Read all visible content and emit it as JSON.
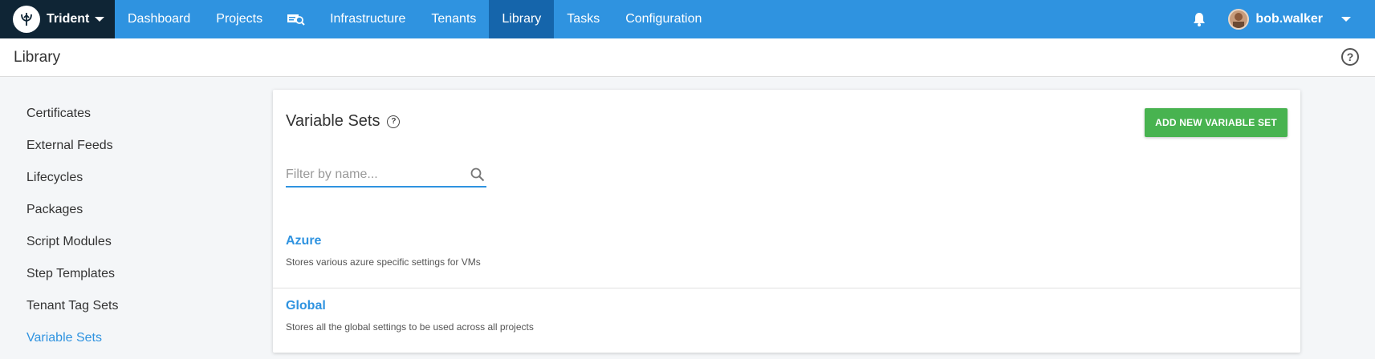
{
  "brand": {
    "name": "Trident"
  },
  "nav": {
    "items": [
      {
        "label": "Dashboard"
      },
      {
        "label": "Projects"
      },
      {
        "label": "Infrastructure"
      },
      {
        "label": "Tenants"
      },
      {
        "label": "Library"
      },
      {
        "label": "Tasks"
      },
      {
        "label": "Configuration"
      }
    ],
    "active": "Library"
  },
  "user": {
    "name": "bob.walker"
  },
  "header": {
    "title": "Library"
  },
  "sidebar": {
    "items": [
      {
        "label": "Certificates"
      },
      {
        "label": "External Feeds"
      },
      {
        "label": "Lifecycles"
      },
      {
        "label": "Packages"
      },
      {
        "label": "Script Modules"
      },
      {
        "label": "Step Templates"
      },
      {
        "label": "Tenant Tag Sets"
      },
      {
        "label": "Variable Sets"
      }
    ],
    "active": "Variable Sets"
  },
  "card": {
    "title": "Variable Sets",
    "add_button": "ADD NEW VARIABLE SET",
    "filter_placeholder": "Filter by name...",
    "rows": [
      {
        "name": "Azure",
        "description": "Stores various azure specific settings for VMs"
      },
      {
        "name": "Global",
        "description": "Stores all the global settings to be used across all projects"
      }
    ]
  },
  "colors": {
    "nav": "#2f93e0",
    "nav_active": "#1565ab",
    "brand_bg": "#0f2535",
    "accent": "#2f93e0",
    "add_button": "#48b350"
  },
  "icons": [
    "trident-logo-icon",
    "chevron-down-icon",
    "search-projects-icon",
    "bell-icon",
    "avatar",
    "help-icon",
    "search-icon"
  ]
}
